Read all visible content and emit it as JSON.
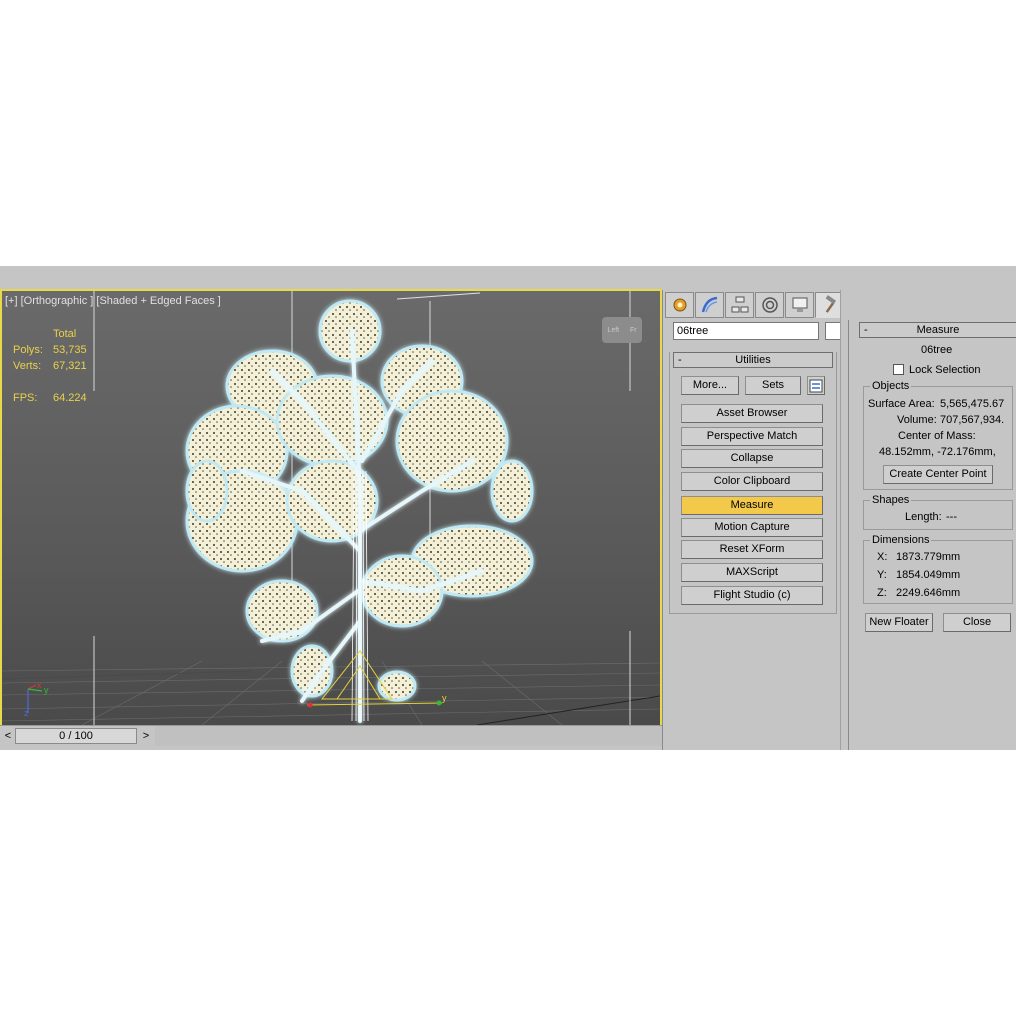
{
  "viewport": {
    "label": "[+] [Orthographic ] [Shaded + Edged Faces ]",
    "stats": {
      "total_label": "Total",
      "polys_label": "Polys:",
      "polys_value": "53,735",
      "verts_label": "Verts:",
      "verts_value": "67,321",
      "fps_label": "FPS:",
      "fps_value": "64.224"
    },
    "viewcube": {
      "left": "Left",
      "right": "Fr"
    }
  },
  "timeline": {
    "prev": "<",
    "next": ">",
    "frame": "0 / 100",
    "progress": 0
  },
  "command_panel": {
    "tabs": [
      {
        "icon": "create-icon"
      },
      {
        "icon": "modify-icon"
      },
      {
        "icon": "hierarchy-icon"
      },
      {
        "icon": "motion-icon"
      },
      {
        "icon": "display-icon"
      },
      {
        "icon": "utilities-icon",
        "active": true
      }
    ],
    "object_name": "06tree",
    "utilities": {
      "title": "Utilities",
      "more_label": "More...",
      "sets_label": "Sets",
      "buttons": [
        "Asset Browser",
        "Perspective Match",
        "Collapse",
        "Color Clipboard",
        "Measure",
        "Motion Capture",
        "Reset XForm",
        "MAXScript",
        "Flight Studio (c)"
      ],
      "active_button": "Measure"
    }
  },
  "measure": {
    "title": "Measure",
    "object_name": "06tree",
    "lock_selection_label": "Lock Selection",
    "lock_selection_checked": false,
    "objects_title": "Objects",
    "surface_area_label": "Surface Area:",
    "surface_area_value": "5,565,475.67",
    "volume_label": "Volume:",
    "volume_value": "707,567,934.",
    "center_of_mass_label": "Center of Mass:",
    "center_of_mass_value": "48.152mm, -72.176mm,",
    "create_center_point_label": "Create Center Point",
    "shapes_title": "Shapes",
    "length_label": "Length:",
    "length_value": "---",
    "dimensions_title": "Dimensions",
    "x_label": "X:",
    "x_value": "1873.779mm",
    "y_label": "Y:",
    "y_value": "1854.049mm",
    "z_label": "Z:",
    "z_value": "2249.646mm",
    "new_floater_label": "New Floater",
    "close_label": "Close"
  },
  "colors": {
    "viewport_border": "#e7d94a",
    "stats_text": "#e8d24b",
    "active_button": "#f2c94a",
    "tree_glow": "#bfe9f5",
    "leaf": "#f4f0d8"
  }
}
